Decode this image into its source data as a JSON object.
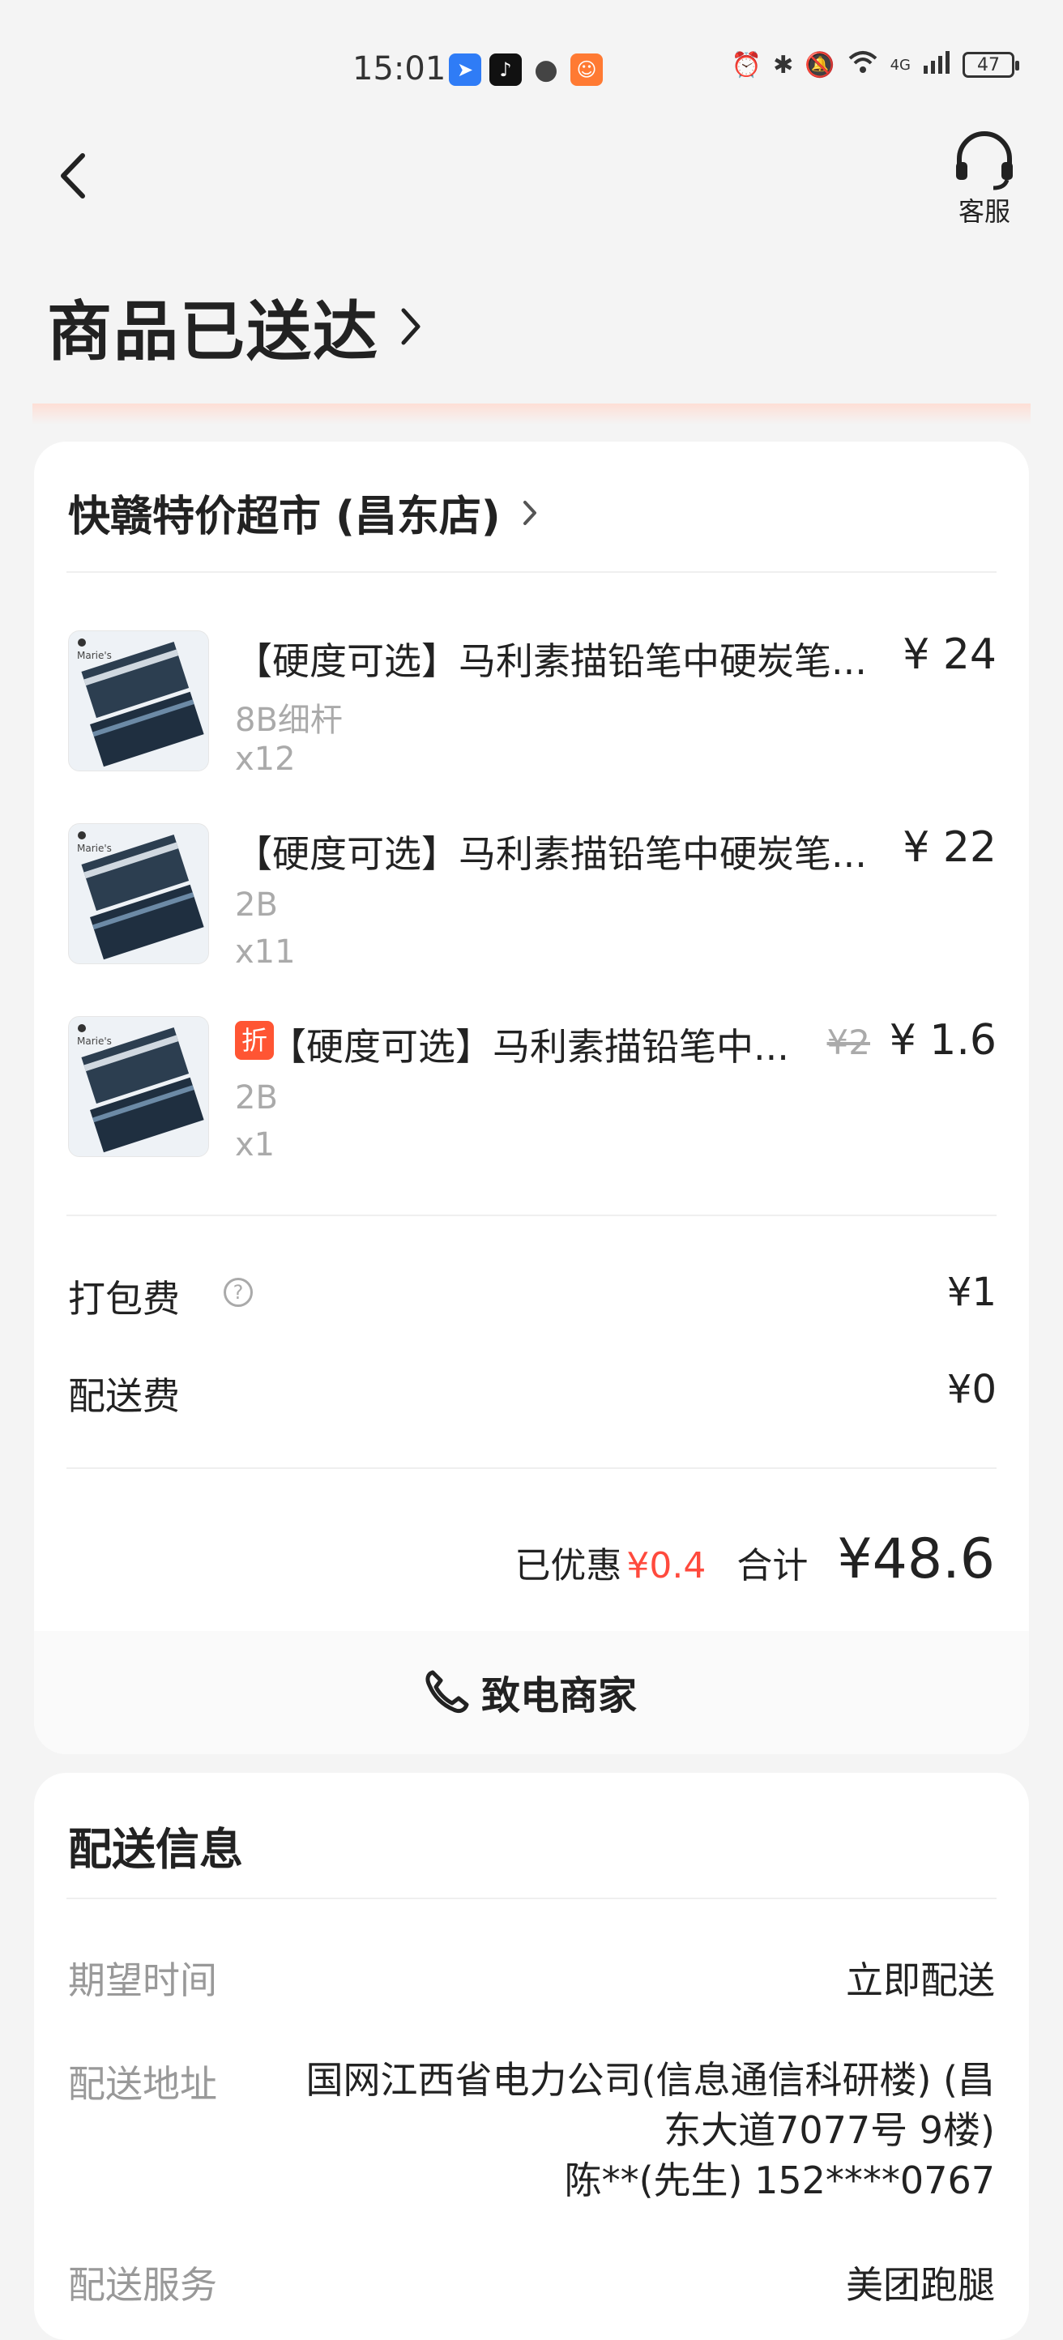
{
  "status_bar": {
    "time": "15:01",
    "battery": "47",
    "signal_text": "4G"
  },
  "header": {
    "back_icon": "chevron-left-icon",
    "service_label": "客服",
    "page_title": "商品已送达"
  },
  "order": {
    "shop_name": "快赣特价超市 (昌东店)",
    "items": [
      {
        "title": "【硬度可选】马利素描铅笔中硬炭笔...",
        "spec": "8B细杆",
        "qty": "x12",
        "price": "¥ 24",
        "original_price": "",
        "discount_tag": ""
      },
      {
        "title": "【硬度可选】马利素描铅笔中硬炭笔...",
        "spec": "2B",
        "qty": "x11",
        "price": "¥ 22",
        "original_price": "",
        "discount_tag": ""
      },
      {
        "title": "【硬度可选】马利素描铅笔中...",
        "spec": "2B",
        "qty": "x1",
        "price": "¥ 1.6",
        "original_price": "¥2",
        "discount_tag": "折"
      }
    ],
    "fees": [
      {
        "label": "打包费",
        "value": "¥1",
        "help": "?"
      },
      {
        "label": "配送费",
        "value": "¥0"
      }
    ],
    "saved_label": "已优惠",
    "saved_value": "¥0.4",
    "total_label": "合计",
    "total_value": "¥48.6",
    "call_label": "致电商家",
    "thumbnail_brand": "Marie's"
  },
  "delivery": {
    "title": "配送信息",
    "rows": [
      {
        "label": "期望时间",
        "value": "立即配送"
      },
      {
        "label": "配送地址",
        "address_line1": "国网江西省电力公司(信息通信科研楼) (昌",
        "address_line2": "东大道7077号 9楼)",
        "address_line3": "陈**(先生) 152****0767"
      },
      {
        "label": "配送服务",
        "value": "美团跑腿"
      }
    ]
  },
  "colors": {
    "accent_red": "#ff4a3d",
    "discount_tag": "#ff5533",
    "background": "#f4f4f4"
  }
}
